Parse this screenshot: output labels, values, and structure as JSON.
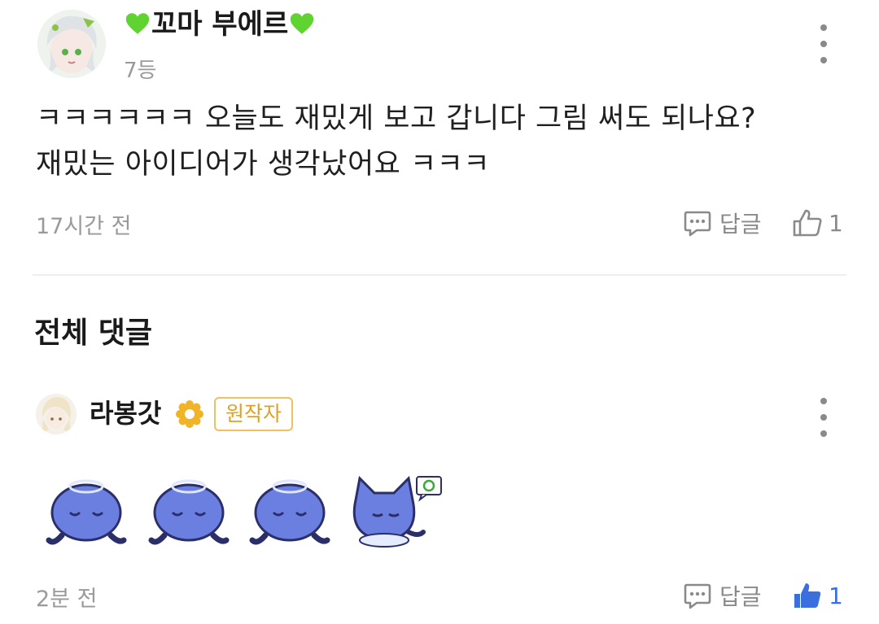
{
  "comment": {
    "author": "꼬마 부에르",
    "rank": "7등",
    "body_line1": "ㅋㅋㅋㅋㅋㅋ 오늘도 재밌게 보고 갑니다 그림 써도 되나요?",
    "body_line2": "재밌는 아이디어가 생각났어요 ㅋㅋㅋ",
    "time": "17시간 전",
    "reply_label": "답글",
    "like_count": "1"
  },
  "section": {
    "title": "전체 댓글"
  },
  "reply": {
    "author": "라봉갓",
    "badge": "원작자",
    "time": "2분 전",
    "reply_label": "답글",
    "like_count": "1"
  },
  "colors": {
    "heart": "#5fd330",
    "like_active": "#3a6fe0",
    "badge": "#f0c060"
  }
}
